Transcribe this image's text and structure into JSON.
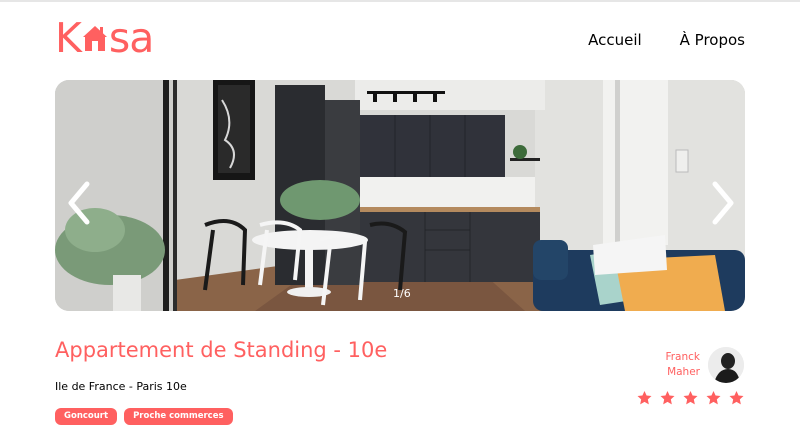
{
  "app": {
    "brand": "Kasa",
    "logo_parts": [
      "K",
      "sa"
    ],
    "accent": "#ff6060"
  },
  "nav": {
    "items": [
      {
        "label": "Accueil"
      },
      {
        "label": "À Propos"
      }
    ]
  },
  "gallery": {
    "counter": "1/6",
    "prev_icon": "chevron-left-icon",
    "next_icon": "chevron-right-icon"
  },
  "listing": {
    "title": "Appartement de Standing - 10e",
    "location": "Ile de France - Paris 10e",
    "tags": [
      "Goncourt",
      "Proche commerces"
    ],
    "host": {
      "first_name": "Franck",
      "last_name": "Maher"
    },
    "rating": {
      "value": 5,
      "max": 5,
      "filled_color": "#ff6060"
    }
  }
}
